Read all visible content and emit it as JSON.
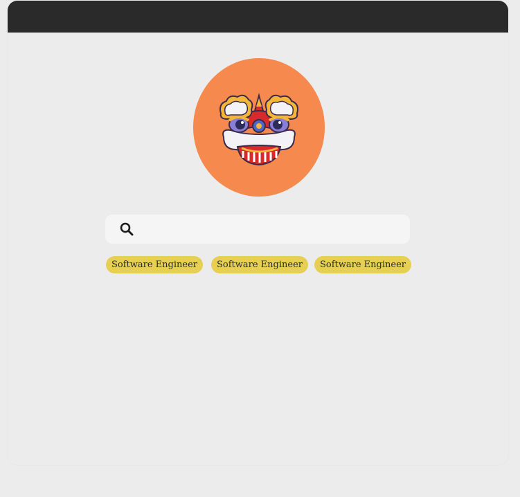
{
  "window": {
    "titlebar_color": "#2a2a2a",
    "background_color": "#ececec"
  },
  "profile": {
    "avatar_icon": "lion-dance-head-icon",
    "avatar_bg_color": "#f5894e"
  },
  "search": {
    "icon": "search-icon",
    "value": "",
    "placeholder": ""
  },
  "tags": [
    {
      "label": "Software Engineer"
    },
    {
      "label": "Software Engineer"
    },
    {
      "label": "Software Engineer"
    }
  ],
  "colors": {
    "tag_bg": "#e7cf54"
  }
}
